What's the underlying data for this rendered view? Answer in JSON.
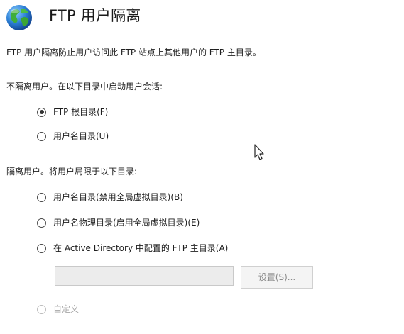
{
  "header": {
    "icon": "globe-icon",
    "title": "FTP 用户隔离"
  },
  "description": "FTP 用户隔离防止用户访问此 FTP 站点上其他用户的 FTP 主目录。",
  "no_isolation": {
    "label": "不隔离用户。在以下目录中启动用户会话:",
    "options": [
      {
        "label": "FTP 根目录(F)",
        "checked": true,
        "enabled": true
      },
      {
        "label": "用户名目录(U)",
        "checked": false,
        "enabled": true
      }
    ]
  },
  "isolation": {
    "label": "隔离用户。将用户局限于以下目录:",
    "options": [
      {
        "label": "用户名目录(禁用全局虚拟目录)(B)",
        "checked": false,
        "enabled": true
      },
      {
        "label": "用户名物理目录(启用全局虚拟目录)(E)",
        "checked": false,
        "enabled": true
      },
      {
        "label": "在 Active Directory 中配置的 FTP 主目录(A)",
        "checked": false,
        "enabled": true
      }
    ],
    "ad_directory_value": "",
    "settings_button_label": "设置(S)...",
    "custom_option": {
      "label": "自定义",
      "checked": false,
      "enabled": false
    }
  },
  "colors": {
    "text": "#1e1e1e",
    "disabled_text": "#a6a6a6",
    "field_background": "#ececec"
  }
}
